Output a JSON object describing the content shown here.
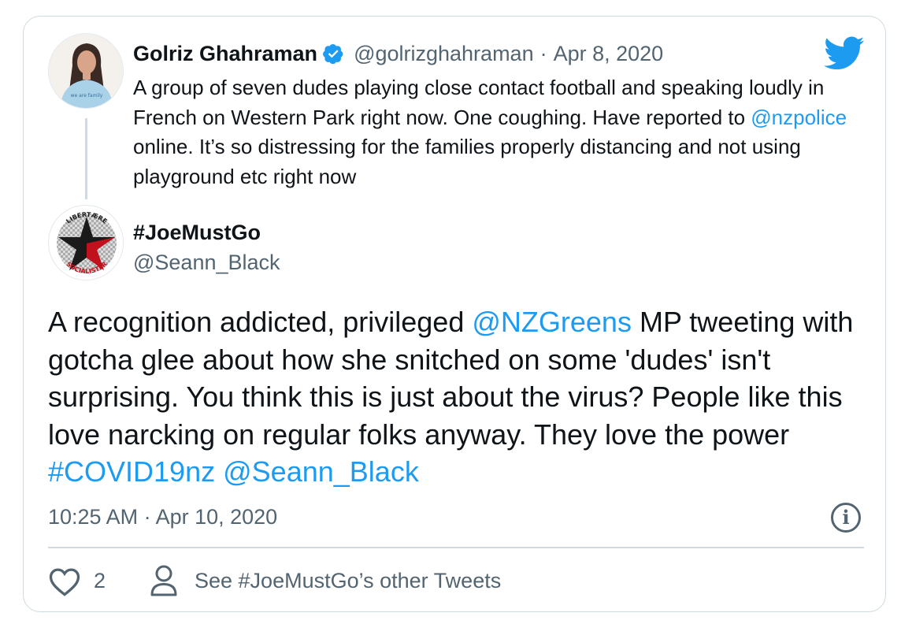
{
  "quoted_tweet": {
    "display_name": "Golriz Ghahraman",
    "handle": "@golrizghahraman",
    "separator": "·",
    "date": "Apr 8, 2020",
    "text_part1": "A group of seven dudes playing close contact football and speaking loudly in French on Western Park right now. One coughing. Have reported to ",
    "mention": "@nzpolice",
    "text_part2": " online. It’s so distressing for the families properly distancing and not using playground etc right now",
    "verified_icon": "verified-badge-icon",
    "avatar_icon": "illustrated-portrait-avatar",
    "avatar_shirt_text": "we are family"
  },
  "tweet": {
    "display_name": "#JoeMustGo",
    "handle": "@Seann_Black",
    "avatar_icon": "libertaere-socialister-star-logo",
    "avatar_logo_top": "LIBERTÆRE",
    "avatar_logo_bottom": "SOCIALISTER",
    "text_part1": "A recognition addicted, privileged ",
    "mention_greens": "@NZGreens",
    "text_part2": " MP tweeting with gotcha glee about how she snitched on some 'dudes' isn't surprising. You think this is just about the virus? People like this love narcking on regular folks anyway. They love the power ",
    "hashtag": "#COVID19nz",
    "text_space": " ",
    "mention_self": "@Seann_Black",
    "timestamp": "10:25 AM · Apr 10, 2020"
  },
  "actions": {
    "like_count": "2",
    "other_tweets_label": "See #JoeMustGo’s other Tweets"
  },
  "colors": {
    "link": "#1d9bf0",
    "muted": "#536471",
    "border": "#cfd9de",
    "twitter_blue": "#1d9bf0",
    "star_red": "#c0111c"
  },
  "icons": {
    "brand": "twitter-bird-icon",
    "info": "info-icon",
    "like": "heart-icon",
    "profile": "person-icon"
  }
}
